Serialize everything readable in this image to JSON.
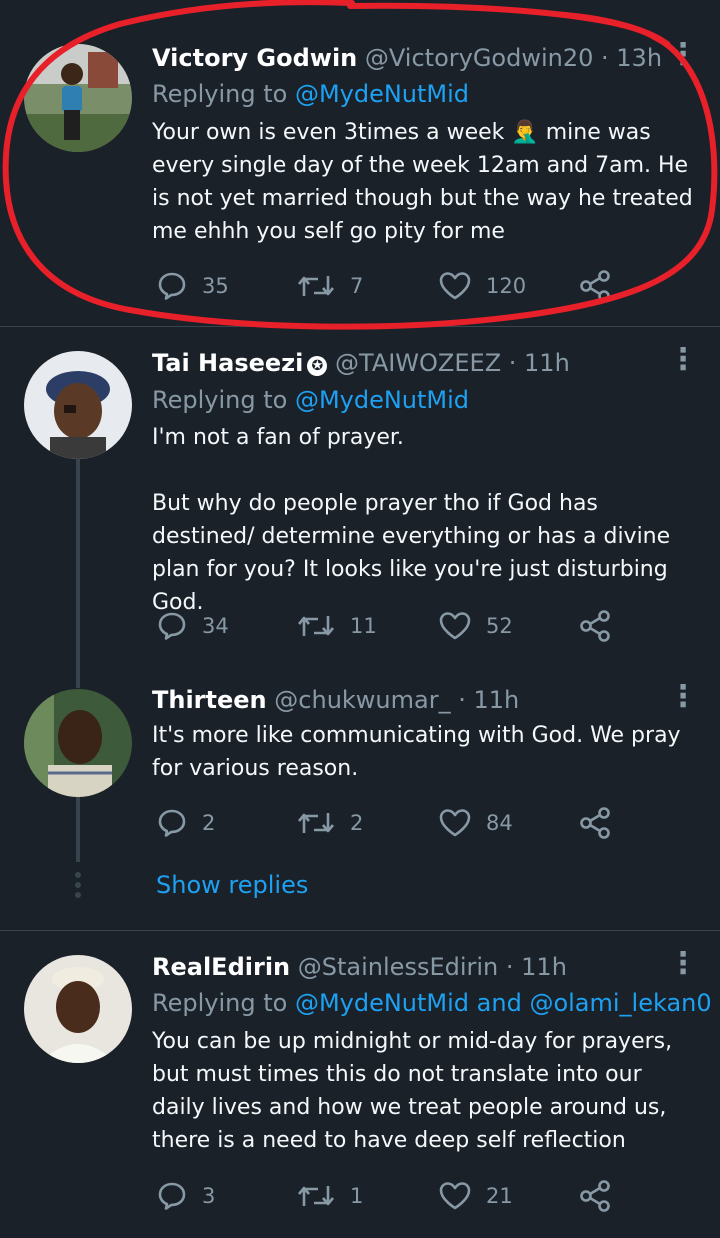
{
  "tweets": [
    {
      "name": "Victory Godwin",
      "verified": false,
      "handle": "@VictoryGodwin20",
      "time": "13h",
      "replying_prefix": "Replying to ",
      "replying_to": "@MydeNutMid",
      "body": "Your own is even 3times a week 🤦‍♂️ mine was every single day of the week 12am and 7am. He is not yet married though but the way he treated me ehhh you self go pity for me",
      "replies": "35",
      "retweets": "7",
      "likes": "120"
    },
    {
      "name": "Tai Haseezi",
      "verified": true,
      "handle": "@TAIWOZEEZ",
      "time": "11h",
      "replying_prefix": "Replying to ",
      "replying_to": "@MydeNutMid",
      "body": "I'm not a fan of prayer.\n\nBut why do people prayer tho if God has destined/ determine everything or has a divine plan for you? It looks like you're just disturbing God.",
      "replies": "34",
      "retweets": "11",
      "likes": "52"
    },
    {
      "name": "Thirteen",
      "verified": false,
      "handle": "@chukwumar_",
      "time": "11h",
      "body": "It's more like communicating with God. We pray for various reason.",
      "replies": "2",
      "retweets": "2",
      "likes": "84"
    },
    {
      "name": "RealEdirin",
      "verified": false,
      "handle": "@StainlessEdirin",
      "time": "11h",
      "replying_prefix": "Replying to ",
      "replying_to": "@MydeNutMid",
      "replying_joiner": " and ",
      "replying_to_2": "@olami_lekan0",
      "body": "You can be up midnight or mid-day for prayers, but must times this do not translate into our daily lives and how we treat people around us, there is a need to have deep self reflection",
      "replies": "3",
      "retweets": "1",
      "likes": "21"
    }
  ],
  "separator": " · ",
  "show_replies": "Show replies",
  "more_glyph": "⋮",
  "verified_glyph": "✪",
  "icons": {
    "reply": "reply-icon",
    "retweet": "retweet-icon",
    "like": "heart-icon",
    "share": "share-icon",
    "more": "more-vertical-icon"
  },
  "colors": {
    "background": "#1b2129",
    "text": "#ffffff",
    "secondary": "#8899a6",
    "link": "#1da1f2",
    "divider": "#38444d",
    "annotation": "#e8202a"
  }
}
